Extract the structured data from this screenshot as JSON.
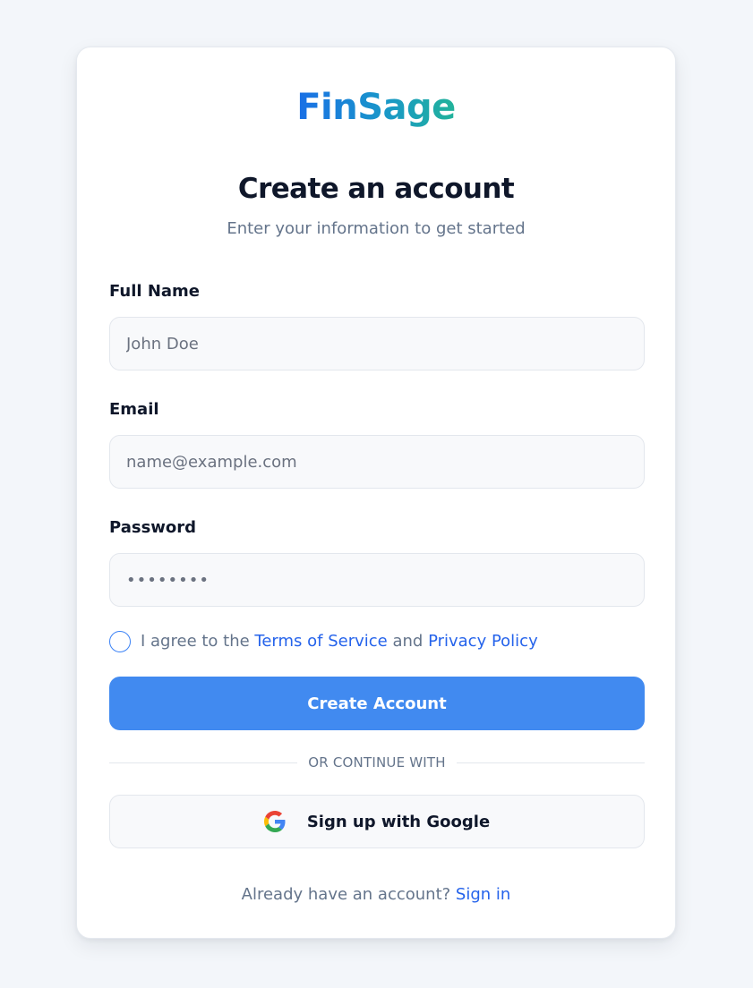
{
  "brand": {
    "name": "FinSage"
  },
  "header": {
    "title": "Create an account",
    "subtitle": "Enter your information to get started"
  },
  "form": {
    "full_name": {
      "label": "Full Name",
      "placeholder": "John Doe",
      "value": ""
    },
    "email": {
      "label": "Email",
      "placeholder": "name@example.com",
      "value": ""
    },
    "password": {
      "label": "Password",
      "placeholder": "••••••••",
      "value": ""
    },
    "agree": {
      "prefix": "I agree to the ",
      "terms_link": "Terms of Service",
      "middle": " and ",
      "privacy_link": "Privacy Policy",
      "checked": false
    },
    "submit_label": "Create Account"
  },
  "divider_text": "OR CONTINUE WITH",
  "google_button": {
    "label": "Sign up with Google",
    "icon": "google-icon"
  },
  "footer": {
    "prompt": "Already have an account? ",
    "signin_link": "Sign in"
  },
  "colors": {
    "primary": "#418af0",
    "link": "#2563eb",
    "brand_gradient_start": "#1a6fe6",
    "brand_gradient_end": "#22b39a"
  }
}
